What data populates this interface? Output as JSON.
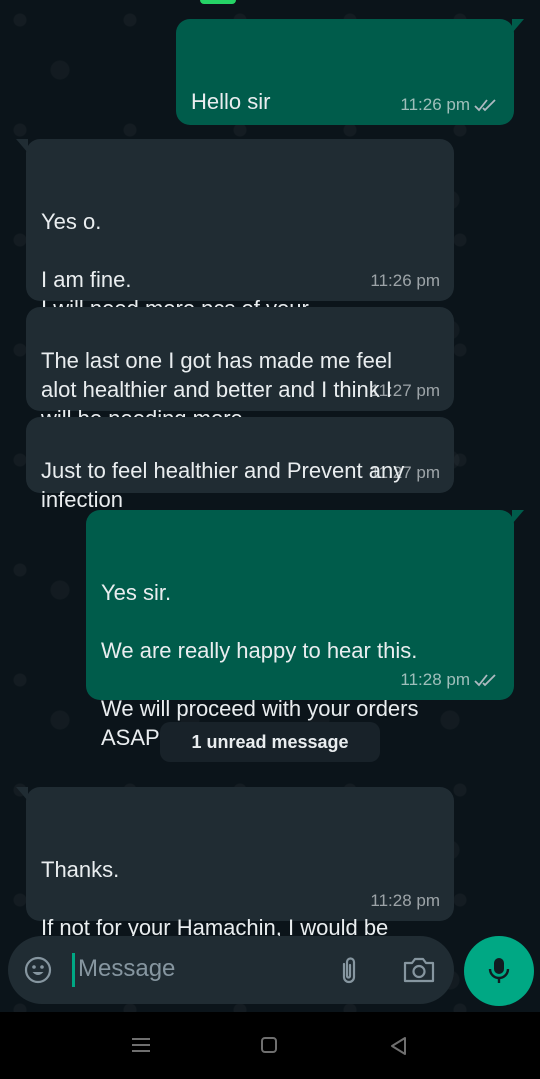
{
  "messages": [
    {
      "direction": "out",
      "text": "Hello sir\n\nTrust you are well.",
      "time": "11:26 pm",
      "ticks": "read"
    },
    {
      "direction": "in",
      "text": "Yes o.\n\nI am fine.\nI will need more pcs of your\nHamachin detox capsule.",
      "time": "11:26 pm"
    },
    {
      "direction": "in",
      "text": "The last one I got has made me feel\nalot healthier and better and I think I\nwill be needing more",
      "time": "11:27 pm"
    },
    {
      "direction": "in",
      "text": "Just to feel healthier and Prevent any\ninfection",
      "time": "11:27 pm"
    },
    {
      "direction": "out",
      "text": "Yes sir.\n\nWe are really happy to hear this.\n\nWe will proceed with your orders\nASAP",
      "time": "11:28 pm",
      "ticks": "read"
    },
    {
      "direction": "in",
      "text": "Thanks.\n\nIf not for your Hamachin, I would be\nbattling infections till now",
      "time": "11:28 pm"
    }
  ],
  "unread_banner": "1 unread message",
  "composer": {
    "placeholder": "Message",
    "icons": [
      "emoji-icon",
      "attach-icon",
      "camera-icon",
      "mic-icon"
    ]
  },
  "navigation": {
    "icons": [
      "menu-icon",
      "home-icon",
      "back-icon"
    ]
  },
  "colors": {
    "background": "#0b141a",
    "outgoing_bubble": "#005c4b",
    "incoming_bubble": "#202c33",
    "accent": "#00a884",
    "meta_text": "#8696a0"
  }
}
